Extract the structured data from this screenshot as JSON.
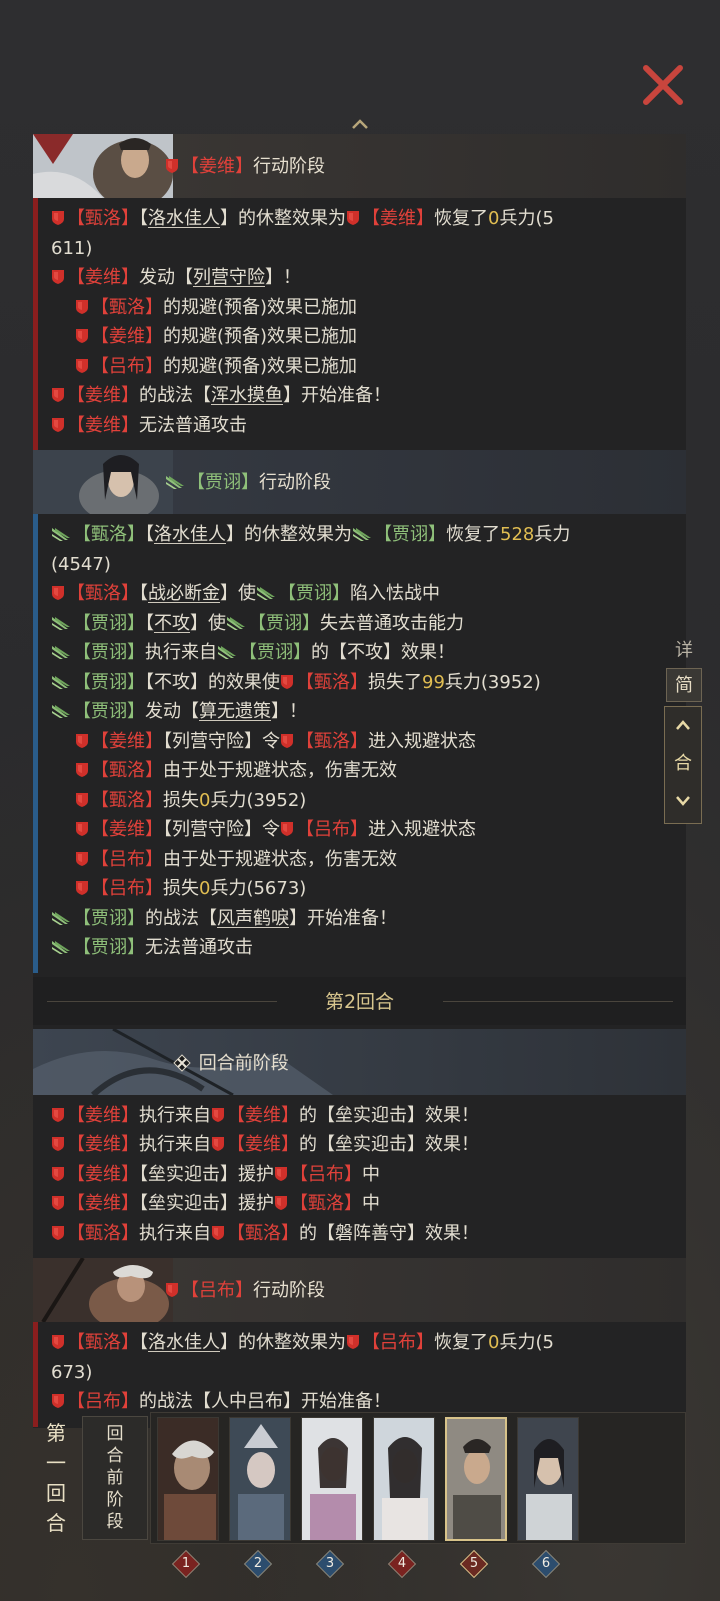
{
  "header": {
    "close_icon": "close-icon",
    "scroll_up_icon": "caret-up-icon"
  },
  "colors": {
    "red_side": "#e0413a",
    "green_side": "#8fc07a",
    "number": "#e0bd52",
    "gold": "#d8c68e"
  },
  "sections": {
    "jiangwei_phase": {
      "lb": "【",
      "name": "姜维",
      "rb": "】",
      "title": "行动阶段"
    },
    "jiaxu_phase": {
      "lb": "【",
      "name": "贾诩",
      "rb": "】",
      "title": "行动阶段"
    },
    "round2": {
      "label": "第2回合"
    },
    "pre_phase": {
      "title": "回合前阶段"
    },
    "lvbu_phase": {
      "lb": "【",
      "name": "吕布",
      "rb": "】",
      "title": "行动阶段"
    }
  },
  "names": {
    "zhenluo": "甄洛",
    "jiangwei": "姜维",
    "lvbu": "吕布",
    "jiaxu": "贾诩"
  },
  "skills": {
    "luoshui": "洛水佳人",
    "lieying": "列营守险",
    "hunshui": "浑水摸鱼",
    "zhanbi": "战必断金",
    "bugong": "不攻",
    "suanwu": "算无遗策",
    "fengsheng": "风声鹤唳",
    "leishi": "垒实迎击",
    "panzhen": "磐阵善守",
    "renzhong": "人中吕布"
  },
  "text": {
    "lb": "【",
    "rb": "】",
    "bang": "！",
    "rest_effect": "的休整效果为",
    "recovered": "恢复了",
    "troops": "兵力",
    "activate": "发动",
    "evade_applied": "的规避(预备)效果已施加",
    "tactic_of": "的战法",
    "start_prepare": "开始准备",
    "cannot_attack": "无法普通攻击",
    "make": "使",
    "fall_timid": "陷入怯战中",
    "lose_attack": "失去普通攻击能力",
    "exec_from": "执行来自",
    "de": "的",
    "effect": "效果",
    "effect_make": "的效果使",
    "lost": "损失了",
    "order": "令",
    "enter_evade": "进入规避状态",
    "evade_no_dmg": "由于处于规避状态，伤害无效",
    "lose": "损失",
    "assist": "援护",
    "zhong": "中",
    "v0": "0",
    "v528": "528",
    "v99": "99",
    "p5611a": "(5",
    "p5611b": "611)",
    "p4547": "(4547)",
    "p3952": "(3952)",
    "p5673": "(5673)",
    "p5673a": "(5",
    "p5673b": "673)"
  },
  "side_panel": {
    "tab_detail": "详",
    "tab_brief": "简",
    "up_icon": "chevron-up-icon",
    "merge_label": "合",
    "down_icon": "chevron-down-icon"
  },
  "bottom": {
    "round_label_chars": [
      "第",
      "一",
      "回",
      "合"
    ],
    "pre_phase_chars": [
      "回",
      "合",
      "前",
      "阶",
      "段"
    ],
    "cards": [
      {
        "num": "1",
        "side": "red"
      },
      {
        "num": "2",
        "side": "blue"
      },
      {
        "num": "3",
        "side": "blue"
      },
      {
        "num": "4",
        "side": "red"
      },
      {
        "num": "5",
        "side": "red"
      },
      {
        "num": "6",
        "side": "blue"
      }
    ]
  }
}
